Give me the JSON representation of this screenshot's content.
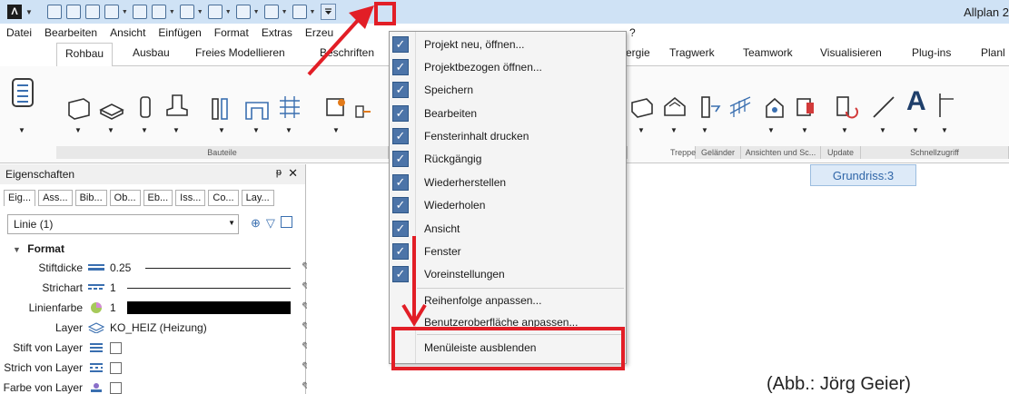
{
  "titlebar": {
    "app_logo": "Λ",
    "title": "Allplan 2",
    "qat_customize_icon": "customize-qat-icon"
  },
  "menubar": [
    "Datei",
    "Bearbeiten",
    "Ansicht",
    "Einfügen",
    "Format",
    "Extras",
    "Erzeu"
  ],
  "menubar_tail": "?",
  "ribbon_tabs": [
    "Rohbau",
    "Ausbau",
    "Freies Modellieren",
    "Beschriften",
    "ergie",
    "Tragwerk",
    "Teamwork",
    "Visualisieren",
    "Plug-ins",
    "Planl"
  ],
  "ribbon_groups": {
    "bauteile": "Bauteile",
    "treppe": "Treppe",
    "gelaender": "Geländer",
    "ansichten": "Ansichten und Sc...",
    "update": "Update",
    "schnellzugriff": "Schnellzugriff"
  },
  "panel": {
    "title": "Eigenschaften",
    "pin": "ᵽ",
    "close": "✕",
    "tabs": [
      "Eig...",
      "Ass...",
      "Bib...",
      "Ob...",
      "Eb...",
      "Iss...",
      "Co...",
      "Lay..."
    ],
    "selection": "Linie (1)",
    "section": "Format",
    "rows": [
      {
        "label": "Stiftdicke",
        "value": "0.25"
      },
      {
        "label": "Strichart",
        "value": "1"
      },
      {
        "label": "Linienfarbe",
        "value": "1"
      },
      {
        "label": "Layer",
        "value": "KO_HEIZ (Heizung)"
      },
      {
        "label": "Stift von Layer",
        "value": ""
      },
      {
        "label": "Strich von Layer",
        "value": ""
      },
      {
        "label": "Farbe von Layer",
        "value": ""
      }
    ]
  },
  "viewport": {
    "label": "Grundriss:3"
  },
  "dropdown": {
    "checked_items": [
      "Projekt neu, öffnen...",
      "Projektbezogen öffnen...",
      "Speichern",
      "Bearbeiten",
      "Fensterinhalt drucken",
      "Rückgängig",
      "Wiederherstellen",
      "Wiederholen",
      "Ansicht",
      "Fenster",
      "Voreinstellungen"
    ],
    "reorder": "Reihenfolge anpassen...",
    "customize": "Benutzeroberfläche anpassen...",
    "hide_menubar": "Menüleiste ausblenden"
  },
  "caption": "(Abb.: Jörg Geier)",
  "colors": {
    "accent": "#4c74a8",
    "annotation": "#e21e26",
    "titlebar": "#cfe2f5"
  }
}
